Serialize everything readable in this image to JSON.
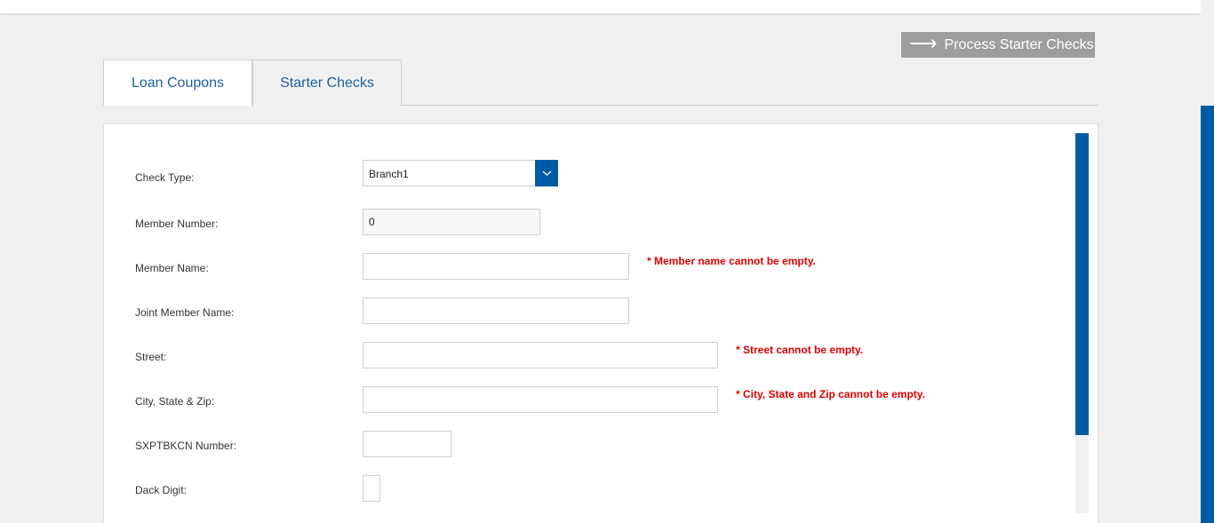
{
  "toolbar": {
    "process_label": "Process Starter Checks",
    "process_icon": "arrow-right-icon"
  },
  "tabs": [
    {
      "label": "Loan Coupons"
    },
    {
      "label": "Starter Checks"
    }
  ],
  "form": {
    "check_type": {
      "label": "Check Type:",
      "value": "Branch1"
    },
    "member_number": {
      "label": "Member Number:",
      "value": "0"
    },
    "member_name": {
      "label": "Member Name:",
      "value": "",
      "error": "* Member name cannot be empty."
    },
    "joint_member_name": {
      "label": "Joint Member Name:",
      "value": ""
    },
    "street": {
      "label": "Street:",
      "value": "",
      "error": "* Street cannot be empty."
    },
    "city_state_zip": {
      "label": "City, State & Zip:",
      "value": "",
      "error": "* City, State and Zip cannot be empty."
    },
    "sxptbkcn_number": {
      "label": "SXPTBKCN Number:",
      "value": ""
    },
    "dack_digit": {
      "label": "Dack Digit:",
      "value": ""
    }
  },
  "colors": {
    "accent": "#005ba5",
    "error": "#e00000",
    "button_gray": "#9e9e9e",
    "tab_text": "#1d5fa0"
  }
}
